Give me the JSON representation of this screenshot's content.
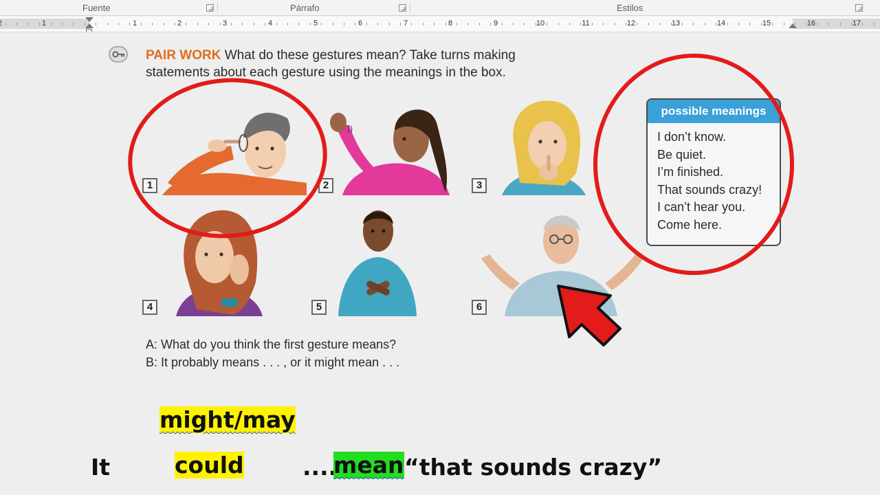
{
  "ribbon": {
    "groups": [
      {
        "label": "Fuente"
      },
      {
        "label": "Párrafo"
      },
      {
        "label": "Estilos"
      }
    ]
  },
  "ruler": {
    "left_numbers": [
      "2",
      "1"
    ],
    "numbers": [
      "1",
      "2",
      "3",
      "4",
      "5",
      "6",
      "7",
      "8",
      "9",
      "10",
      "11",
      "12",
      "13",
      "14",
      "15",
      "16",
      "17"
    ]
  },
  "exercise": {
    "label": "PAIR WORK",
    "instruction": "What do these gestures mean? Take turns making statements about each gesture using the meanings in the box.",
    "gesture_numbers": [
      "1",
      "2",
      "3",
      "4",
      "5",
      "6"
    ]
  },
  "meanings_box": {
    "title": "possible meanings",
    "items": [
      "I don’t know.",
      "Be quiet.",
      "I’m finished.",
      "That sounds crazy!",
      "I can’t hear you.",
      "Come here."
    ]
  },
  "dialog": {
    "a": "A:  What do you think the first gesture means?",
    "b": "B:  It probably means . . . , or it might mean . . ."
  },
  "annotation": {
    "modal_top": "might/may",
    "subject": "It",
    "modal": "could",
    "dots": ".....",
    "verb": "mean",
    "quote": "“that sounds crazy”"
  },
  "colors": {
    "accent_orange": "#e06c1a",
    "box_header_blue": "#3aa0d8",
    "annotation_red": "#e21b1b",
    "highlight_yellow": "#fff200",
    "highlight_green": "#22dd22"
  }
}
